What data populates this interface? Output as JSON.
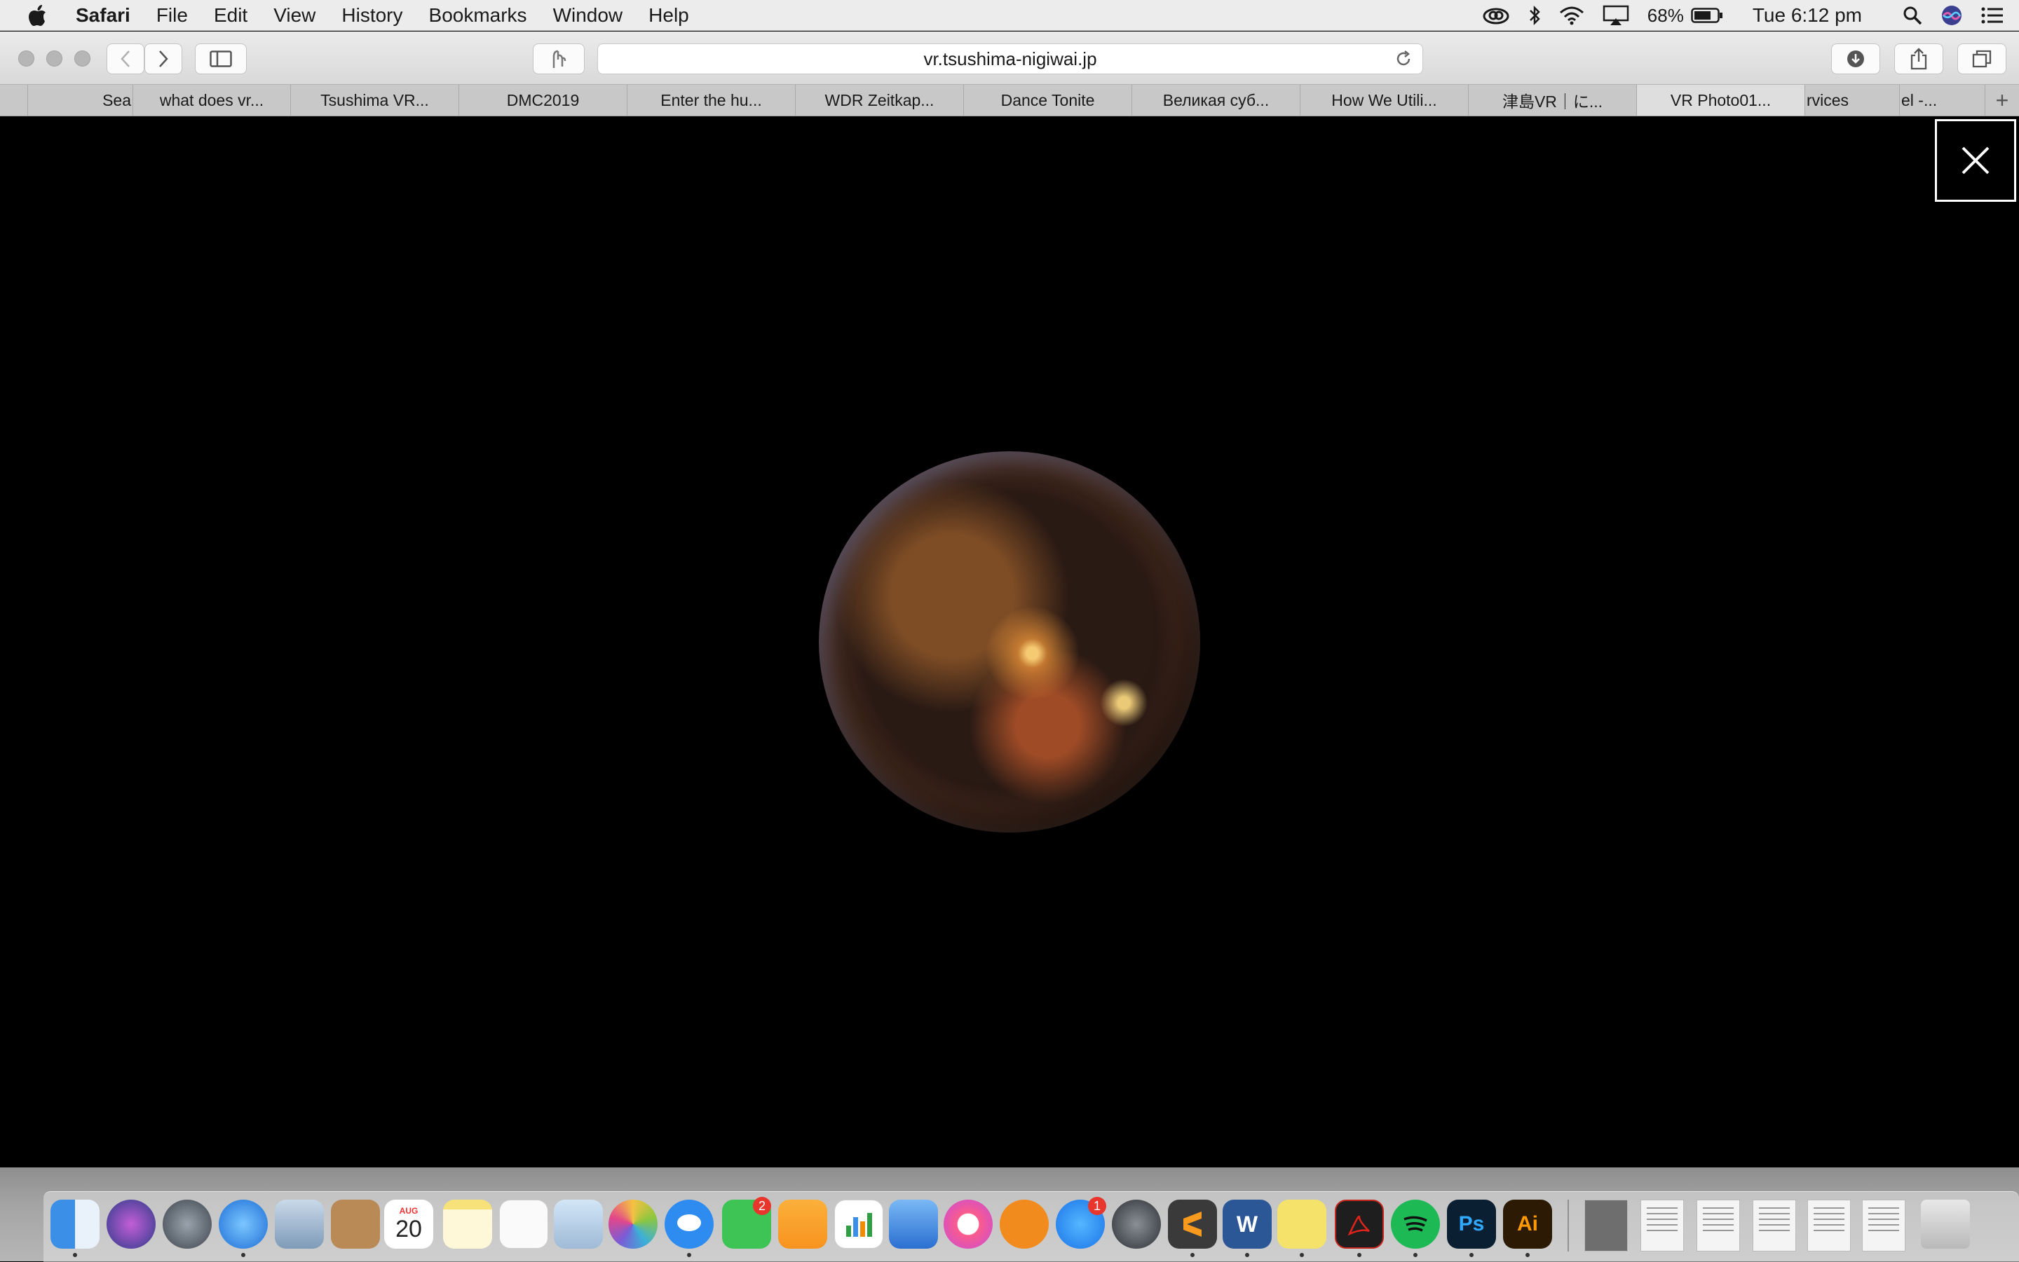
{
  "menubar": {
    "app_name": "Safari",
    "menus": [
      "File",
      "Edit",
      "View",
      "History",
      "Bookmarks",
      "Window",
      "Help"
    ],
    "battery_percent": "68%",
    "clock": "Tue 6:12 pm"
  },
  "toolbar": {
    "url": "vr.tsushima-nigiwai.jp"
  },
  "tabs": [
    {
      "label": ""
    },
    {
      "label": "Sea"
    },
    {
      "label": "what does vr..."
    },
    {
      "label": "Tsushima VR..."
    },
    {
      "label": "DMC2019"
    },
    {
      "label": "Enter the hu..."
    },
    {
      "label": "WDR Zeitkap..."
    },
    {
      "label": "Dance Tonite"
    },
    {
      "label": "Великая суб..."
    },
    {
      "label": "How We Utili..."
    },
    {
      "label": "津島VR｜に..."
    },
    {
      "label": "VR Photo01..."
    },
    {
      "label": "rvices"
    },
    {
      "label": "el -..."
    }
  ],
  "tab_add_label": "+",
  "dock": {
    "calendar_month": "AUG",
    "calendar_day": "20",
    "facetime_badge": "2",
    "appstore_badge": "1",
    "photoshop_label": "Ps",
    "illustrator_label": "Ai"
  },
  "colors": {
    "menubar_bg": "#ececec",
    "content_bg": "#000000",
    "badge_red": "#e8362d"
  }
}
